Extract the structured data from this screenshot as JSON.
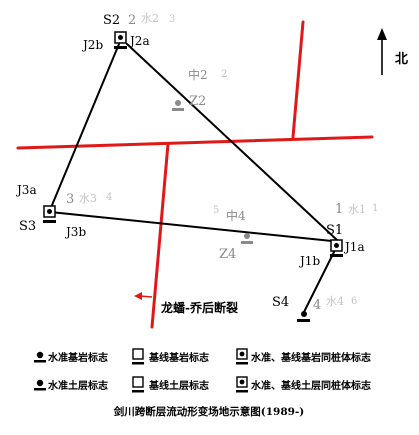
{
  "north": {
    "label": "北"
  },
  "fault": {
    "label": "龙蟠-乔后断裂"
  },
  "stations": {
    "S1": {
      "name": "S1",
      "num": "1",
      "cn": "水1",
      "ghost": "1",
      "j1": "J1b",
      "j2": "J1a"
    },
    "S2": {
      "name": "S2",
      "num": "2",
      "cn": "水2",
      "ghost": "3",
      "j1": "J2b",
      "j2": "J2a"
    },
    "S3": {
      "name": "S3",
      "num": "3",
      "cn": "水3",
      "ghost": "4",
      "j1": "J3a",
      "j2": "J3b"
    },
    "S4": {
      "name": "S4",
      "num": "4",
      "cn": "水4",
      "ghost": "6"
    },
    "Z2": {
      "name": "Z2",
      "cn": "中2",
      "ghost": "2"
    },
    "Z4": {
      "name": "Z4",
      "cn": "中4",
      "ghost": "5"
    }
  },
  "legend": {
    "row1": [
      "水准基岩标志",
      "基线基岩标志",
      "水准、基线基岩同桩体标志"
    ],
    "row2": [
      "水准土层标志",
      "基线土层标志",
      "水准、基线土层同桩体标志"
    ]
  },
  "caption": "剑川跨断层流动形变场地示意图(1989-)",
  "colors": {
    "fault": "#e01818",
    "line": "#000000",
    "gray": "#8a8a8a"
  }
}
